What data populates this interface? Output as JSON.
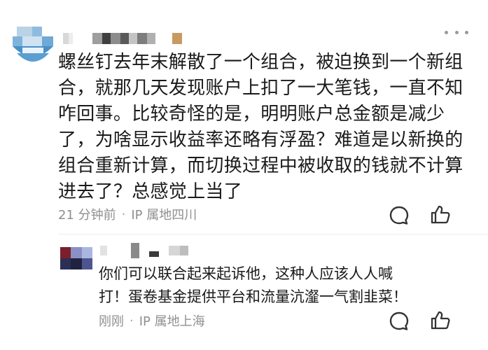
{
  "comment": {
    "text": "螺丝钉去年末解散了一个组合，被迫换到一个新组\n合，就那几天发现账户上扣了一大笔钱，一直不知\n咋回事。比较奇怪的是，明明账户总金额是减少\n了，为啥显示收益率还略有浮盈？难道是以新换的\n组合重新计算，而切换过程中被收取的钱就不计算\n进去了？总感觉上当了",
    "time": "21 分钟前",
    "separator": "·",
    "location": "IP 属地四川"
  },
  "reply": {
    "text": "你们可以联合起来起诉他，这种人应该人人喊\n打！蛋卷基金提供平台和流量沆瀣一气割韭菜！",
    "time": "刚刚",
    "separator": "·",
    "location": "IP 属地上海"
  },
  "icons": {
    "more": "more-dots-icon",
    "comment": "comment-bubble-icon",
    "like": "thumbs-up-icon"
  },
  "colors": {
    "text": "#1a1a1a",
    "meta": "#8f8f8f",
    "icon": "#333333",
    "divider": "#ededed"
  }
}
